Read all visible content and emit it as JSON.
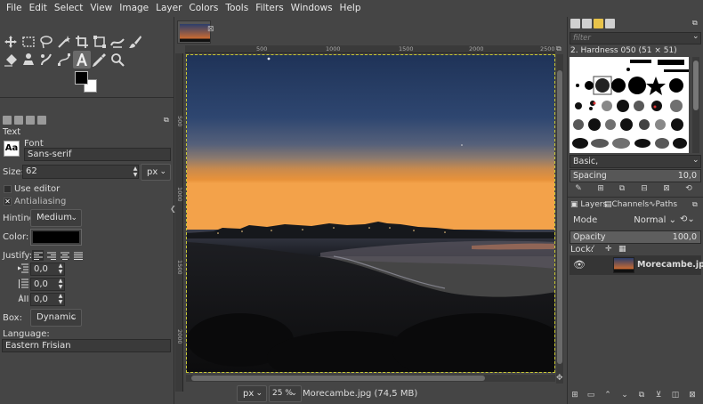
{
  "menu": [
    "File",
    "Edit",
    "Select",
    "View",
    "Image",
    "Layer",
    "Colors",
    "Tools",
    "Filters",
    "Windows",
    "Help"
  ],
  "tool_options": {
    "title": "Text",
    "font_label": "Font",
    "font_value": "Sans-serif",
    "font_preview": "Aa",
    "size_label": "Size:",
    "size_value": "62",
    "size_unit": "px",
    "use_editor": "Use editor",
    "antialiasing": "Antialiasing",
    "hinting_label": "Hinting:",
    "hinting_value": "Medium",
    "color_label": "Color:",
    "color_value": "#000000",
    "justify_label": "Justify:",
    "indent_value": "0,0",
    "line_spacing_value": "0,0",
    "letter_spacing_value": "0,0",
    "box_label": "Box:",
    "box_value": "Dynamic",
    "language_label": "Language:",
    "language_value": "Eastern Frisian"
  },
  "canvas": {
    "ruler_h": [
      "500",
      "1000",
      "1500",
      "2000",
      "2500"
    ],
    "ruler_v": [
      "500",
      "1000",
      "1500",
      "2000"
    ],
    "unit": "px",
    "zoom": "25 %",
    "status": "Morecambe.jpg (74,5 MB)"
  },
  "brushes": {
    "filter_placeholder": "filter",
    "current": "2. Hardness 050 (51 × 51)",
    "preset": "Basic,",
    "spacing_label": "Spacing",
    "spacing_value": "10,0"
  },
  "layers": {
    "tabs": [
      "Layers",
      "Channels",
      "Paths"
    ],
    "mode_label": "Mode",
    "mode_value": "Normal",
    "opacity_label": "Opacity",
    "opacity_value": "100,0",
    "opacity_fraction": 1.0,
    "lock_label": "Lock:",
    "layer_name": "Morecambe.jpg"
  }
}
